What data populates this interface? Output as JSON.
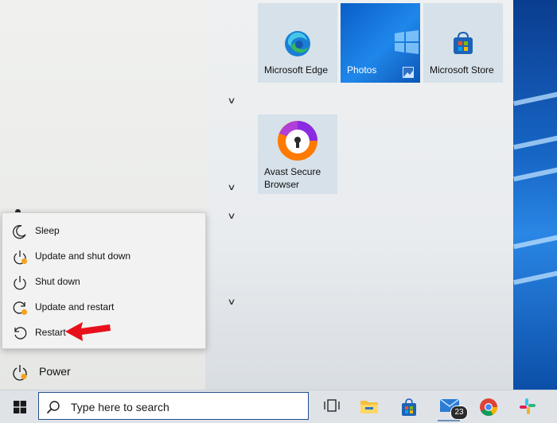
{
  "tiles": {
    "edge": "Microsoft Edge",
    "photos": "Photos",
    "store": "Microsoft Store",
    "avast": "Avast Secure Browser"
  },
  "power_menu": {
    "items": [
      {
        "label": "Sleep",
        "icon": "moon-icon"
      },
      {
        "label": "Update and shut down",
        "icon": "power-update-icon"
      },
      {
        "label": "Shut down",
        "icon": "power-icon"
      },
      {
        "label": "Update and restart",
        "icon": "restart-update-icon"
      },
      {
        "label": "Restart",
        "icon": "restart-icon"
      }
    ]
  },
  "power_row": {
    "label": "Power"
  },
  "taskbar": {
    "search_placeholder": "Type here to search",
    "mail_badge": "23"
  },
  "colors": {
    "accent_orange": "#f7a21b",
    "arrow_red": "#e8101a"
  }
}
